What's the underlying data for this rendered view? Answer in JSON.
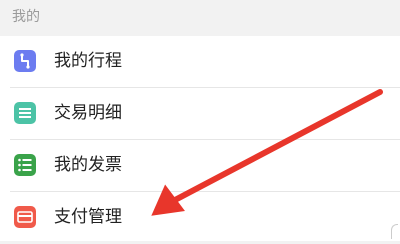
{
  "section": {
    "title": "我的"
  },
  "menu": {
    "items": [
      {
        "label": "我的行程",
        "icon": "route-icon",
        "color": "#6c7cf0"
      },
      {
        "label": "交易明细",
        "icon": "list-icon",
        "color": "#4cc3a6"
      },
      {
        "label": "我的发票",
        "icon": "invoice-icon",
        "color": "#3aa34a"
      },
      {
        "label": "支付管理",
        "icon": "card-icon",
        "color": "#f05a4a"
      }
    ]
  },
  "annotation": {
    "arrow_color": "#e8362b",
    "icon": "arrow-annotation"
  }
}
